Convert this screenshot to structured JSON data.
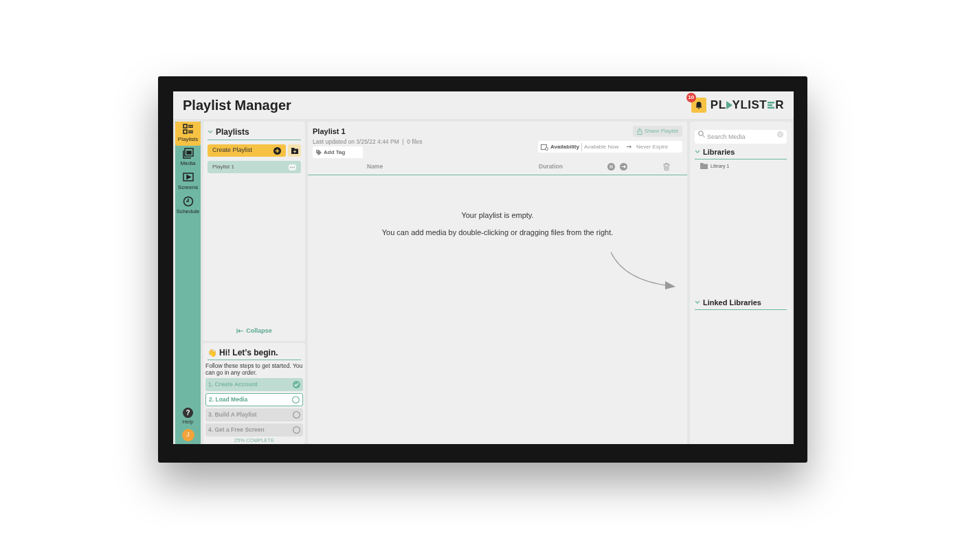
{
  "header": {
    "title": "Playlist Manager",
    "notification_count": "10",
    "logo": {
      "text_start": "PL",
      "text_middle": "YLIST",
      "text_end": "R"
    }
  },
  "nav": {
    "items": [
      {
        "label": "Playlists",
        "selected": true
      },
      {
        "label": "Media",
        "selected": false
      },
      {
        "label": "Screens",
        "selected": false
      },
      {
        "label": "Schedule",
        "selected": false
      }
    ],
    "help_icon": "?",
    "help_label": "Help",
    "avatar_initial": "J"
  },
  "playlists_panel": {
    "title": "Playlists",
    "create_button": "Create Playlist",
    "items": [
      {
        "label": "Playlist 1",
        "selected": true
      }
    ],
    "collapse_label": "Collapse"
  },
  "onboarding": {
    "emoji": "👋",
    "title": "Hi! Let’s begin.",
    "intro": "Follow these steps to get started. You can go in any order.",
    "steps": [
      {
        "label": "1. Create Account",
        "done": true,
        "selected": false
      },
      {
        "label": "2. Load Media",
        "done": false,
        "selected": true
      },
      {
        "label": "3. Build A Playlist",
        "done": false,
        "selected": false
      },
      {
        "label": "4. Get a Free Screen",
        "done": false,
        "selected": false
      }
    ],
    "progress": "25% COMPLETE"
  },
  "playlist": {
    "title": "Playlist 1",
    "subtitle": "Last updated on 3/25/22 4:44 PM  |  0 files",
    "share_button": "Share Playlist",
    "add_tag": "Add Tag",
    "availability": {
      "label": "Availability",
      "start": "Available Now",
      "end": "Never Expire"
    },
    "columns": [
      "Name",
      "Duration"
    ],
    "empty_lines": [
      "Your playlist is empty.",
      "You can add media by double-clicking or dragging files from the right."
    ]
  },
  "media_panel": {
    "search_placeholder": "Search Media",
    "libraries_title": "Libraries",
    "libraries": [
      "Library 1"
    ],
    "linked_title": "Linked Libraries"
  }
}
